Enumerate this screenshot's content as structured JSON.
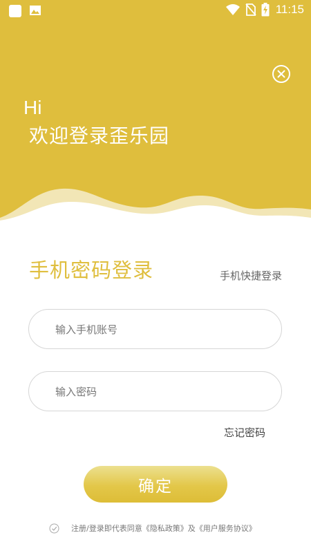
{
  "status_bar": {
    "time": "11:15",
    "icons": [
      "app-square-icon",
      "image-icon",
      "wifi-icon",
      "no-sim-icon",
      "battery-charging-icon"
    ]
  },
  "header": {
    "greeting": "Hi",
    "welcome": "欢迎登录歪乐园",
    "close_icon": "close-circle-icon",
    "background_color": "#dfbe3d"
  },
  "login": {
    "title": "手机密码登录",
    "quick_login_label": "手机快捷登录",
    "phone_placeholder": "输入手机账号",
    "password_placeholder": "输入密码",
    "forgot_label": "忘记密码",
    "confirm_label": "确定",
    "accent_color": "#dfbe3d"
  },
  "agreement": {
    "text": "注册/登录即代表同意《隐私政策》及《用户服务协议》"
  }
}
